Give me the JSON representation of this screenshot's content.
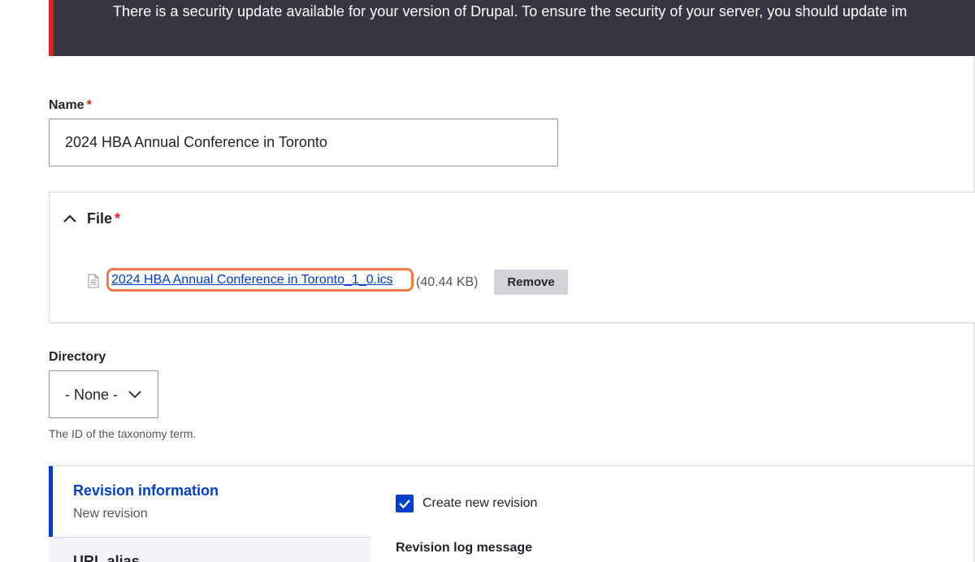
{
  "banner": {
    "message": "There is a security update available for your version of Drupal. To ensure the security of your server, you should update im"
  },
  "name_field": {
    "label": "Name",
    "required_marker": "*",
    "value": "2024 HBA Annual Conference in Toronto"
  },
  "file_field": {
    "label": "File",
    "required_marker": "*",
    "file_name": "2024 HBA Annual Conference in Toronto_1_0.ics",
    "file_size": "(40.44 KB)",
    "remove_label": "Remove"
  },
  "directory_field": {
    "label": "Directory",
    "selected": "- None -",
    "description": "The ID of the taxonomy term."
  },
  "vertical_tabs": {
    "active_tab": {
      "title": "Revision information",
      "summary": "New revision"
    },
    "next_tab": {
      "title": "URL alias"
    }
  },
  "revision": {
    "checkbox_label": "Create new revision",
    "checked": true,
    "log_label": "Revision log message"
  },
  "colors": {
    "banner_bg": "#353641",
    "banner_accent": "#d72222",
    "link": "#003ecc",
    "highlight": "#ee7a45"
  }
}
